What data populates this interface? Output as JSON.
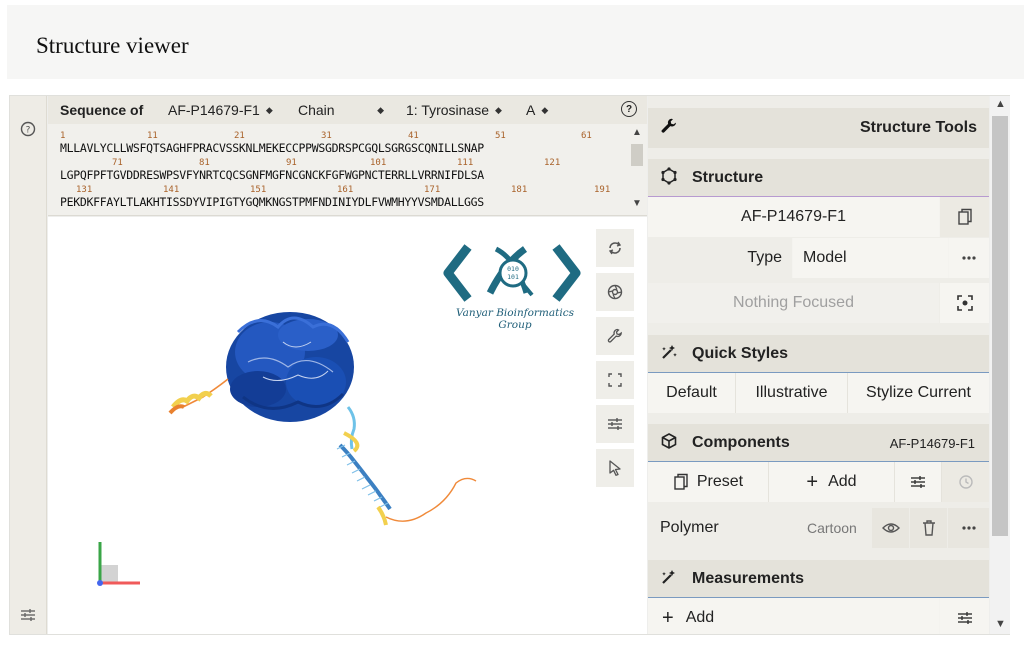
{
  "page": {
    "title": "Structure viewer"
  },
  "sequence": {
    "label": "Sequence of",
    "entry": "AF-P14679-F1",
    "mode": "Chain",
    "chain": "1: Tyrosinase",
    "asym": "A",
    "lines": [
      "MLLAVLYCLLWSFQTSAGHFPRACVSSKNLMEKECCPPWSGDRSPCGQLSGRGSCQNILLSNAP",
      "LGPQFPFTGVDDRESWPSVFYNRTCQCSGNFMGFNCGNCKFGFWGPNCTERRLLVRRNIFDLSA",
      "PEKDKFFAYLTLAKHTISSDYVIPIGTYGQMKNGSTPMFNDINIYDLFVWMHYYVSMDALLGGS"
    ],
    "numbers": [
      [
        "1",
        "11",
        "21",
        "31",
        "41",
        "51",
        "61"
      ],
      [
        "71",
        "81",
        "91",
        "101",
        "111",
        "121"
      ],
      [
        "131",
        "141",
        "151",
        "161",
        "171",
        "181",
        "191"
      ]
    ]
  },
  "logo": {
    "name": "Vanyar Bioinformatics Group",
    "digits_top": "010",
    "digits_bottom": "101"
  },
  "tools": {
    "title": "Structure Tools",
    "structure": {
      "title": "Structure",
      "entry": "AF-P14679-F1",
      "type_label": "Type",
      "type_value": "Model",
      "focus": "Nothing Focused"
    },
    "quick_styles": {
      "title": "Quick Styles",
      "options": [
        "Default",
        "Illustrative",
        "Stylize Current"
      ]
    },
    "components": {
      "title": "Components",
      "entry": "AF-P14679-F1",
      "preset": "Preset",
      "add": "Add",
      "polymer": "Polymer",
      "representation": "Cartoon"
    },
    "measurements": {
      "title": "Measurements",
      "add": "Add"
    }
  },
  "colors": {
    "protein_blue": "#1746a2",
    "model_orange": "#f08a3a",
    "model_yellow": "#f2d04e",
    "model_cyan": "#6ec2e8"
  }
}
